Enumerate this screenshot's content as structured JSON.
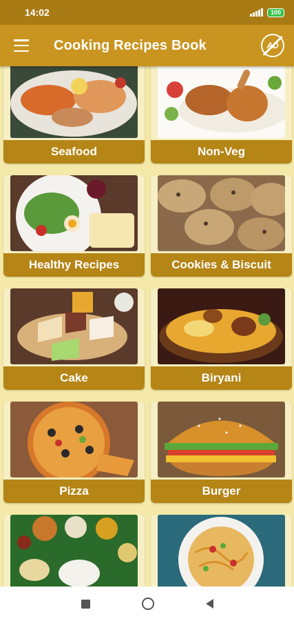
{
  "status": {
    "time": "14:02",
    "battery": "100"
  },
  "app_bar": {
    "title": "Cooking Recipes Book",
    "no_ads_icon_text": "AD"
  },
  "categories": [
    {
      "label": "Seafood",
      "icon": "seafood-platter-photo"
    },
    {
      "label": "Non-Veg",
      "icon": "roast-chicken-photo"
    },
    {
      "label": "Healthy Recipes",
      "icon": "salad-plate-photo"
    },
    {
      "label": "Cookies & Biscuit",
      "icon": "cookies-photo"
    },
    {
      "label": "Cake",
      "icon": "cake-slices-photo"
    },
    {
      "label": "Biryani",
      "icon": "biryani-photo"
    },
    {
      "label": "Pizza",
      "icon": "pizza-photo"
    },
    {
      "label": "Burger",
      "icon": "burger-photo"
    },
    {
      "label": "",
      "icon": "thali-meal-photo"
    },
    {
      "label": "",
      "icon": "spaghetti-photo"
    }
  ],
  "colors": {
    "status_bar": "#a87b14",
    "app_bar": "#c99520",
    "card_label": "#b58516",
    "background": "#f4e9a8"
  }
}
